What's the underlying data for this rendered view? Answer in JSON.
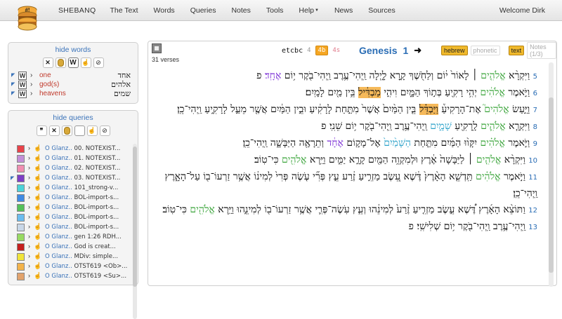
{
  "nav": {
    "brand": "SHEBANQ",
    "items": [
      "The Text",
      "Words",
      "Queries",
      "Notes",
      "Tools",
      "Help",
      "News",
      "Sources"
    ],
    "welcome": "Welcome Dirk"
  },
  "logo_text": "#!",
  "words_panel": {
    "title": "hide words",
    "items": [
      {
        "gloss": "one",
        "hebrew": "אחד"
      },
      {
        "gloss": "god(s)",
        "hebrew": "אלהים"
      },
      {
        "gloss": "heavens",
        "hebrew": "שמים"
      }
    ]
  },
  "queries_panel": {
    "title": "hide queries",
    "items": [
      {
        "color": "#e8434a",
        "author": "O Glanz..",
        "name": "00. NOTEXIST..."
      },
      {
        "color": "#c38fd8",
        "author": "O Glanz..",
        "name": "01. NOTEXIST..."
      },
      {
        "color": "#f08fb1",
        "author": "O Glanz..",
        "name": "02. NOTEXIST..."
      },
      {
        "color": "#7e3fc6",
        "author": "O Glanz..",
        "name": "03. NOTEXIST..."
      },
      {
        "color": "#4cd3d9",
        "author": "O Glanz..",
        "name": "101_strong-v..."
      },
      {
        "color": "#3f8be4",
        "author": "O Glanz..",
        "name": "BOL-import-s..."
      },
      {
        "color": "#54c15b",
        "author": "O Glanz..",
        "name": "BOL-import-s..."
      },
      {
        "color": "#6bbcef",
        "author": "O Glanz..",
        "name": "BOL-import-s..."
      },
      {
        "color": "#c8d7e7",
        "author": "O Glanz..",
        "name": "BOL-import-s..."
      },
      {
        "color": "#98da62",
        "author": "O Glanz..",
        "name": "gen 1:26 RDH..."
      },
      {
        "color": "#c41f1f",
        "author": "O Glanz..",
        "name": "God is creat..."
      },
      {
        "color": "#f0e43a",
        "author": "O Glanz..",
        "name": "MDiv: simple..."
      },
      {
        "color": "#f3b34a",
        "author": "O Glanz..",
        "name": "OTST619 <Ob>..."
      },
      {
        "color": "#e2a36c",
        "author": "O Glanz..",
        "name": "OTST619 <Su>..."
      }
    ]
  },
  "main": {
    "verses_count": "31 verses",
    "source": "etcbc",
    "versions": [
      "4",
      "4b",
      "4s"
    ],
    "book": "Genesis",
    "chapter": "1",
    "next": "➜",
    "toggles": [
      "hebrew",
      "phonetic",
      "text",
      "Notes (1/3)"
    ]
  },
  "colors": {
    "god": "#3aa43a",
    "one": "#7b2fd6",
    "heavens": "#2aa1c9",
    "highlight": "#f5b95a",
    "link": "#2a6db5"
  }
}
